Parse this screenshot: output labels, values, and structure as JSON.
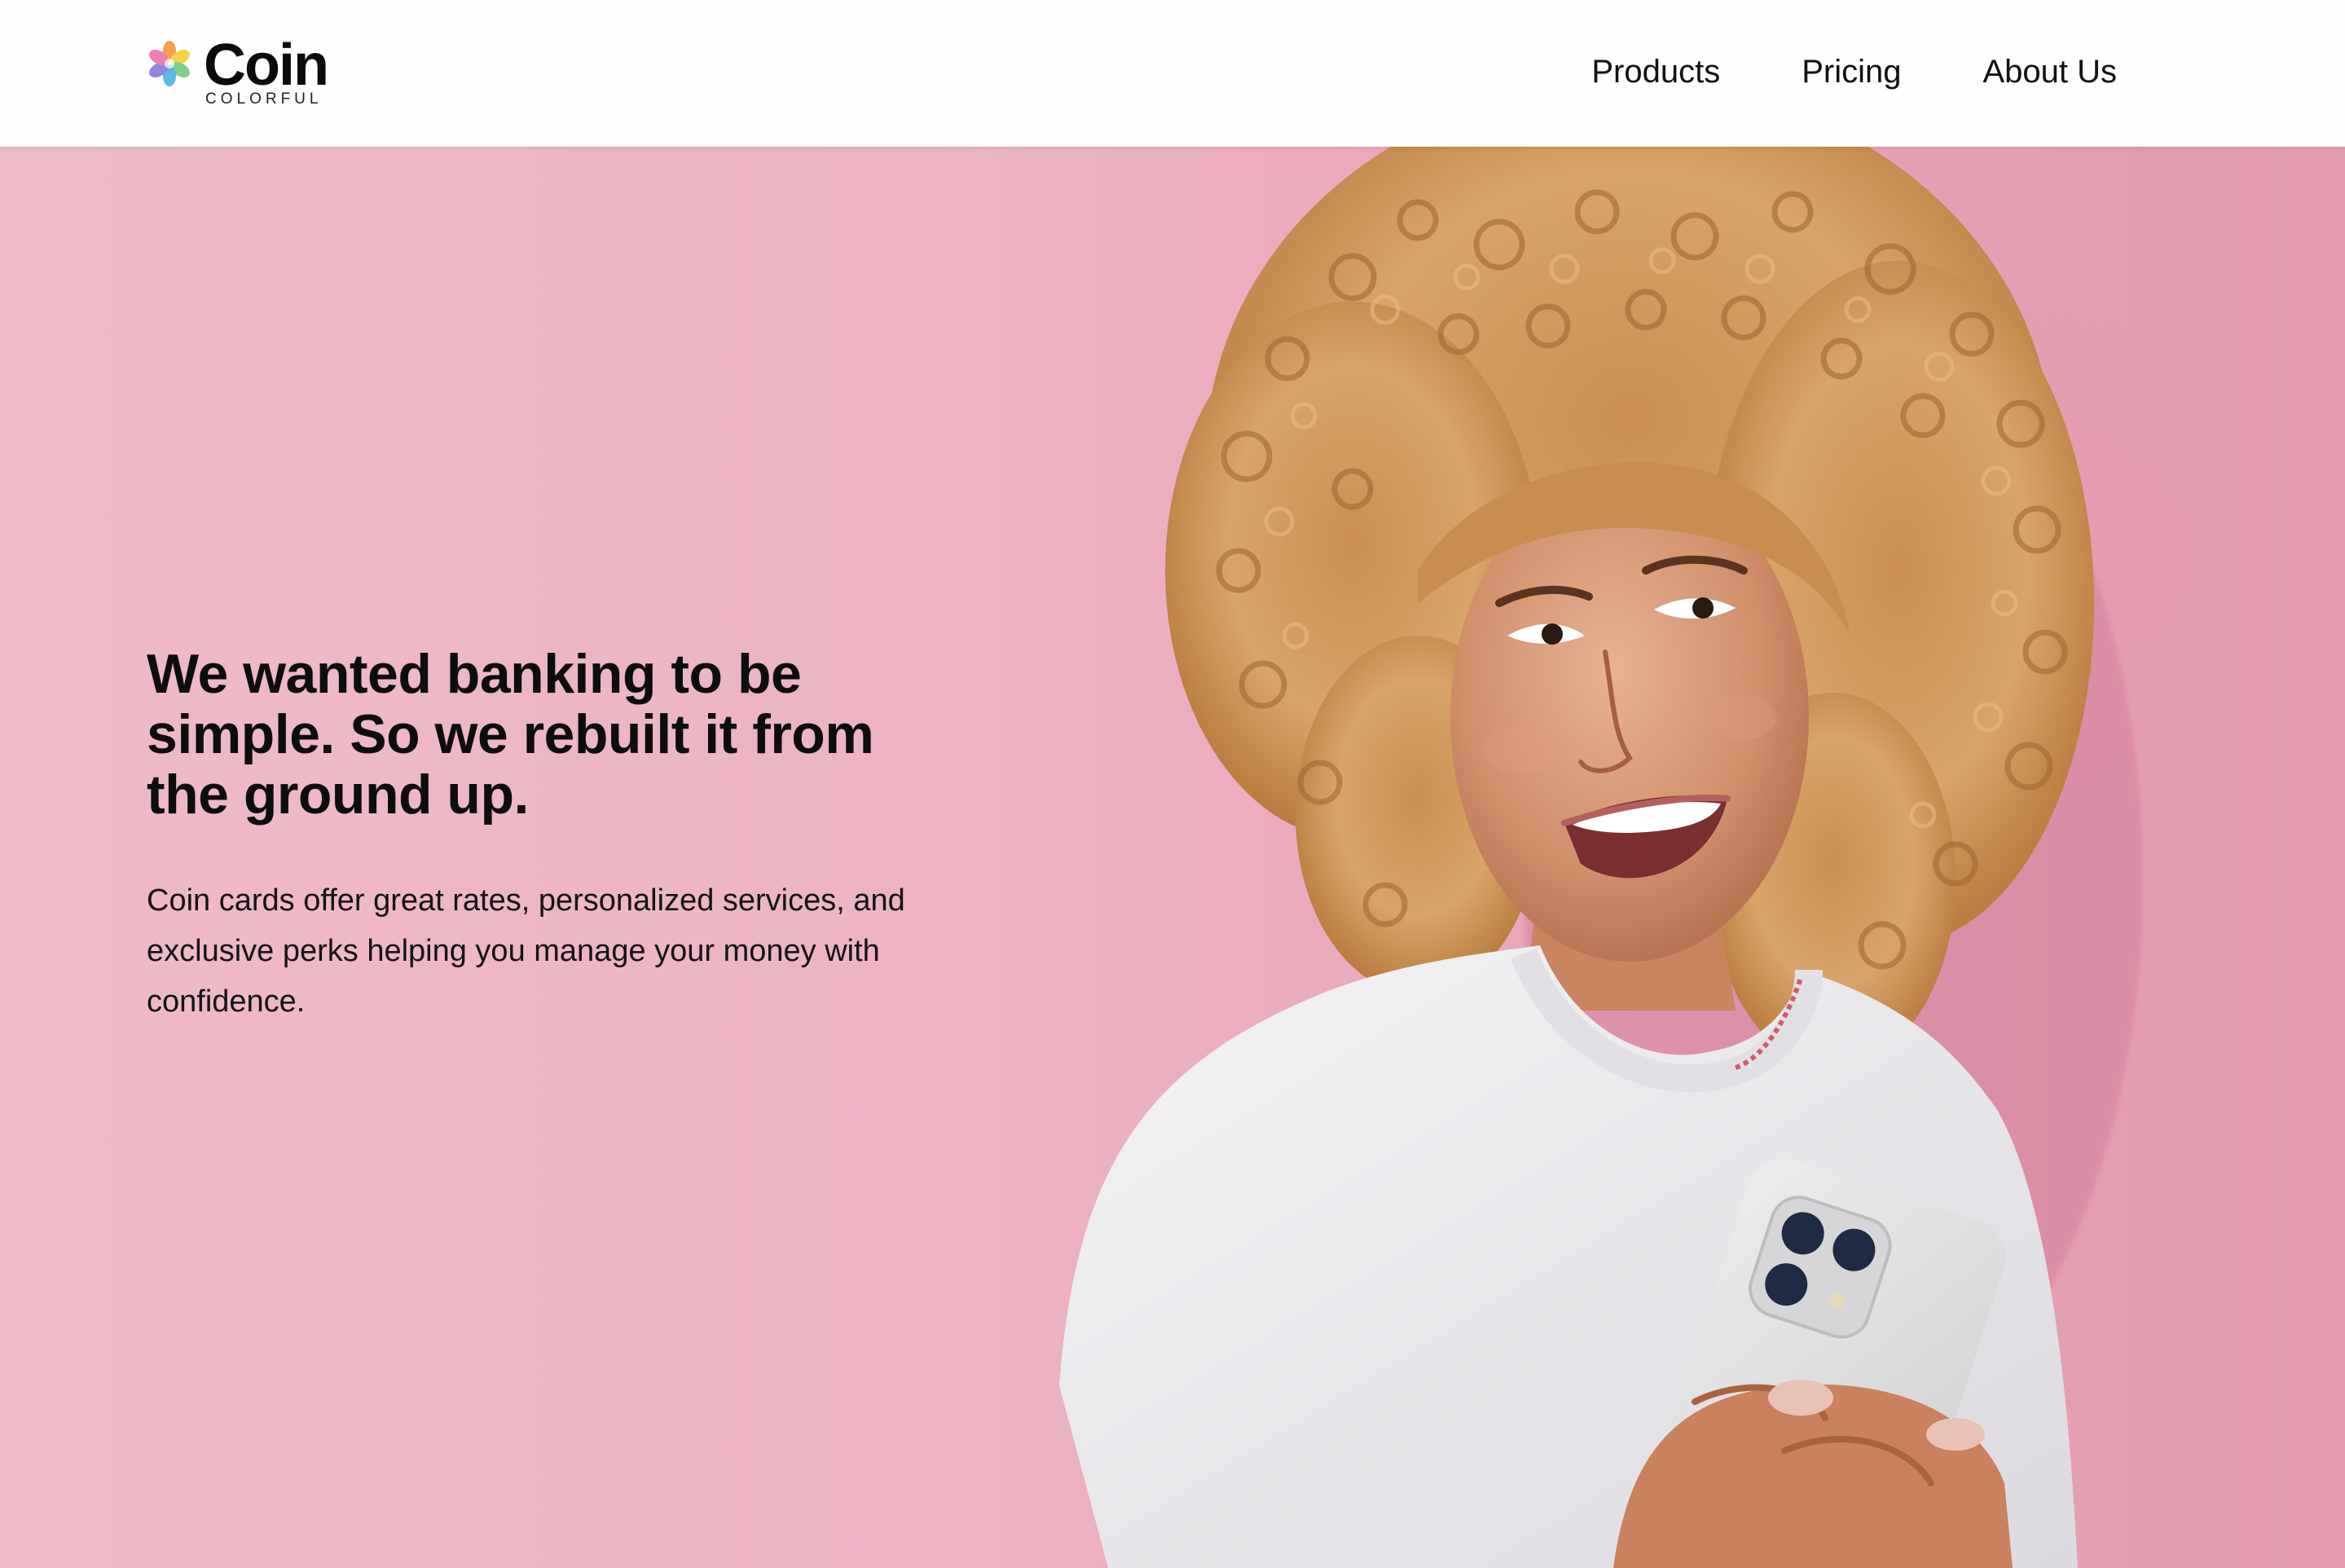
{
  "brand": {
    "name": "Coin",
    "tagline": "COLORFUL",
    "logo_icon": "flower-icon"
  },
  "nav": {
    "items": [
      {
        "label": "Products"
      },
      {
        "label": "Pricing"
      },
      {
        "label": "About Us"
      }
    ]
  },
  "hero": {
    "heading": "We wanted banking to be simple. So we rebuilt it from the ground up.",
    "body": "Coin cards offer great rates, personalized services, and exclusive perks helping you manage your money with confidence.",
    "image_subject": "smiling woman with curly hair holding phone"
  },
  "colors": {
    "header_bg": "#fefefe",
    "hero_bg": "#ecb3c2",
    "text": "#0d0d0d"
  }
}
